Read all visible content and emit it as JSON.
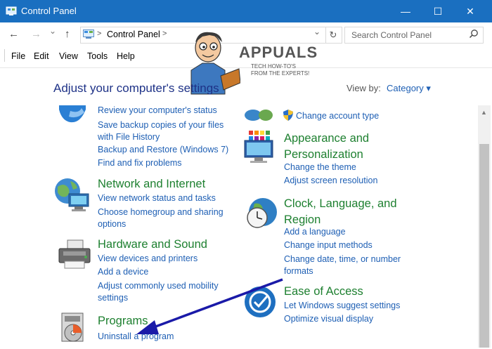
{
  "window": {
    "title": "Control Panel",
    "minimize_glyph": "—",
    "maximize_glyph": "☐",
    "close_glyph": "✕"
  },
  "nav": {
    "back_glyph": "←",
    "forward_glyph": "→",
    "recent_glyph": "⌄",
    "up_glyph": "↑",
    "breadcrumb": "Control Panel",
    "breadcrumb_chevron": ">",
    "dropdown_glyph": "⌄",
    "refresh_glyph": "↻",
    "search_placeholder": "Search Control Panel"
  },
  "menu": [
    "File",
    "Edit",
    "View",
    "Tools",
    "Help"
  ],
  "watermark": {
    "brand": "APPUALS",
    "tagline": "TECH HOW-TO'S FROM THE EXPERTS!"
  },
  "header": {
    "title": "Adjust your computer's settings",
    "view_by_label": "View by:",
    "view_by_value": "Category ▾"
  },
  "categories": [
    {
      "name": "system-and-security",
      "title": "",
      "links": [
        "Review your computer's status",
        "Save backup copies of your files with File History",
        "Backup and Restore (Windows 7)",
        "Find and fix problems"
      ]
    },
    {
      "name": "network-and-internet",
      "title": "Network and Internet",
      "links": [
        "View network status and tasks",
        "Choose homegroup and sharing options"
      ]
    },
    {
      "name": "hardware-and-sound",
      "title": "Hardware and Sound",
      "links": [
        "View devices and printers",
        "Add a device",
        "Adjust commonly used mobility settings"
      ]
    },
    {
      "name": "programs",
      "title": "Programs",
      "links": [
        "Uninstall a program"
      ]
    },
    {
      "name": "user-accounts",
      "title": "",
      "links": [
        "Change account type"
      ]
    },
    {
      "name": "appearance",
      "title": "Appearance and Personalization",
      "links": [
        "Change the theme",
        "Adjust screen resolution"
      ]
    },
    {
      "name": "clock-language-region",
      "title": "Clock, Language, and Region",
      "links": [
        "Add a language",
        "Change input methods",
        "Change date, time, or number formats"
      ]
    },
    {
      "name": "ease-of-access",
      "title": "Ease of Access",
      "links": [
        "Let Windows suggest settings",
        "Optimize visual display"
      ]
    }
  ],
  "colors": {
    "titlebar": "#1a6fc0",
    "category_title": "#1e8030",
    "link": "#1e5fb4",
    "heading": "#1e3287",
    "annotation_arrow": "#1a1aa8"
  }
}
